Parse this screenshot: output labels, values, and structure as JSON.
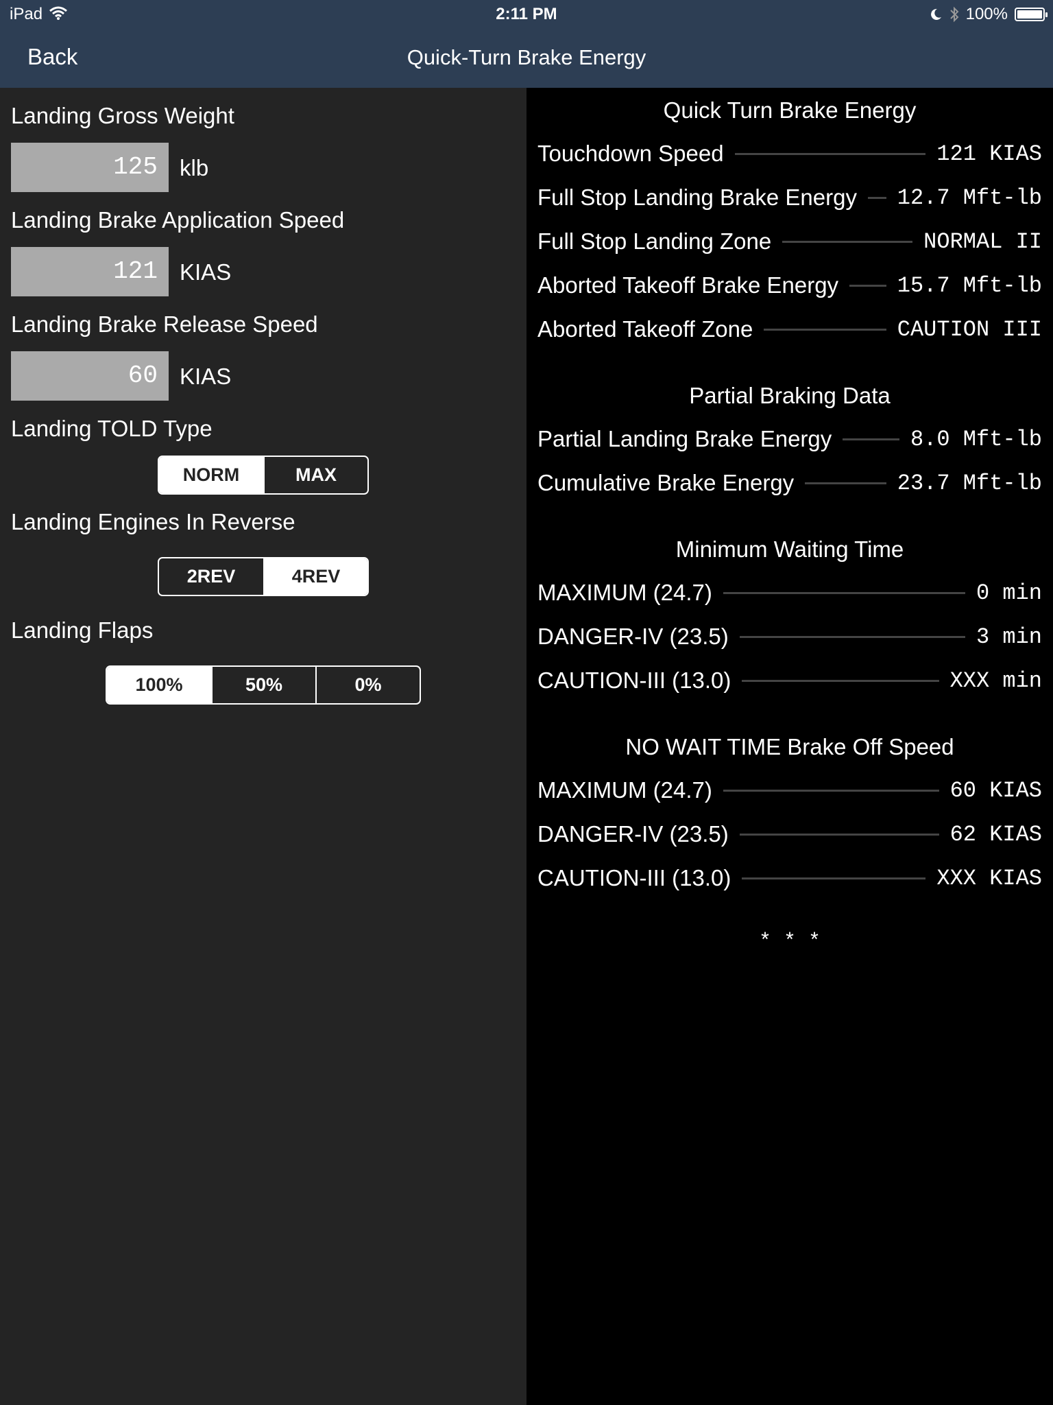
{
  "status_bar": {
    "device": "iPad",
    "time": "2:11 PM",
    "battery": "100%"
  },
  "nav": {
    "back": "Back",
    "title": "Quick-Turn Brake Energy"
  },
  "inputs": {
    "gross_weight": {
      "label": "Landing Gross Weight",
      "value": "125",
      "unit": "klb"
    },
    "app_speed": {
      "label": "Landing Brake Application Speed",
      "value": "121",
      "unit": "KIAS"
    },
    "release_speed": {
      "label": "Landing Brake Release Speed",
      "value": "60",
      "unit": "KIAS"
    }
  },
  "told_type": {
    "label": "Landing TOLD Type",
    "options": [
      "NORM",
      "MAX"
    ],
    "selected": "NORM"
  },
  "reverse": {
    "label": "Landing Engines In Reverse",
    "options": [
      "2REV",
      "4REV"
    ],
    "selected": "4REV"
  },
  "flaps": {
    "label": "Landing Flaps",
    "options": [
      "100%",
      "50%",
      "0%"
    ],
    "selected": "100%"
  },
  "results": {
    "qt_title": "Quick Turn Brake Energy",
    "qt_rows": [
      {
        "label": "Touchdown Speed",
        "value": "121 KIAS"
      },
      {
        "label": "Full Stop Landing Brake Energy",
        "value": "12.7 Mft-lb"
      },
      {
        "label": "Full Stop Landing Zone",
        "value": "NORMAL II "
      },
      {
        "label": "Aborted Takeoff Brake Energy",
        "value": "15.7 Mft-lb"
      },
      {
        "label": "Aborted Takeoff Zone",
        "value": "CAUTION III "
      }
    ],
    "partial_title": "Partial Braking Data",
    "partial_rows": [
      {
        "label": "Partial Landing Brake Energy",
        "value": "8.0 Mft-lb"
      },
      {
        "label": "Cumulative Brake Energy",
        "value": "23.7 Mft-lb"
      }
    ],
    "wait_title": "Minimum Waiting Time",
    "wait_rows": [
      {
        "label": "MAXIMUM (24.7)",
        "value": "0 min"
      },
      {
        "label": "DANGER-IV (23.5)",
        "value": "3 min"
      },
      {
        "label": "CAUTION-III (13.0)",
        "value": "XXX min"
      }
    ],
    "nowait_title": "NO WAIT TIME Brake Off Speed",
    "nowait_rows": [
      {
        "label": "MAXIMUM (24.7)",
        "value": "60 KIAS"
      },
      {
        "label": "DANGER-IV (23.5)",
        "value": "62 KIAS"
      },
      {
        "label": "CAUTION-III (13.0)",
        "value": "XXX KIAS"
      }
    ],
    "footer": "* * *"
  }
}
